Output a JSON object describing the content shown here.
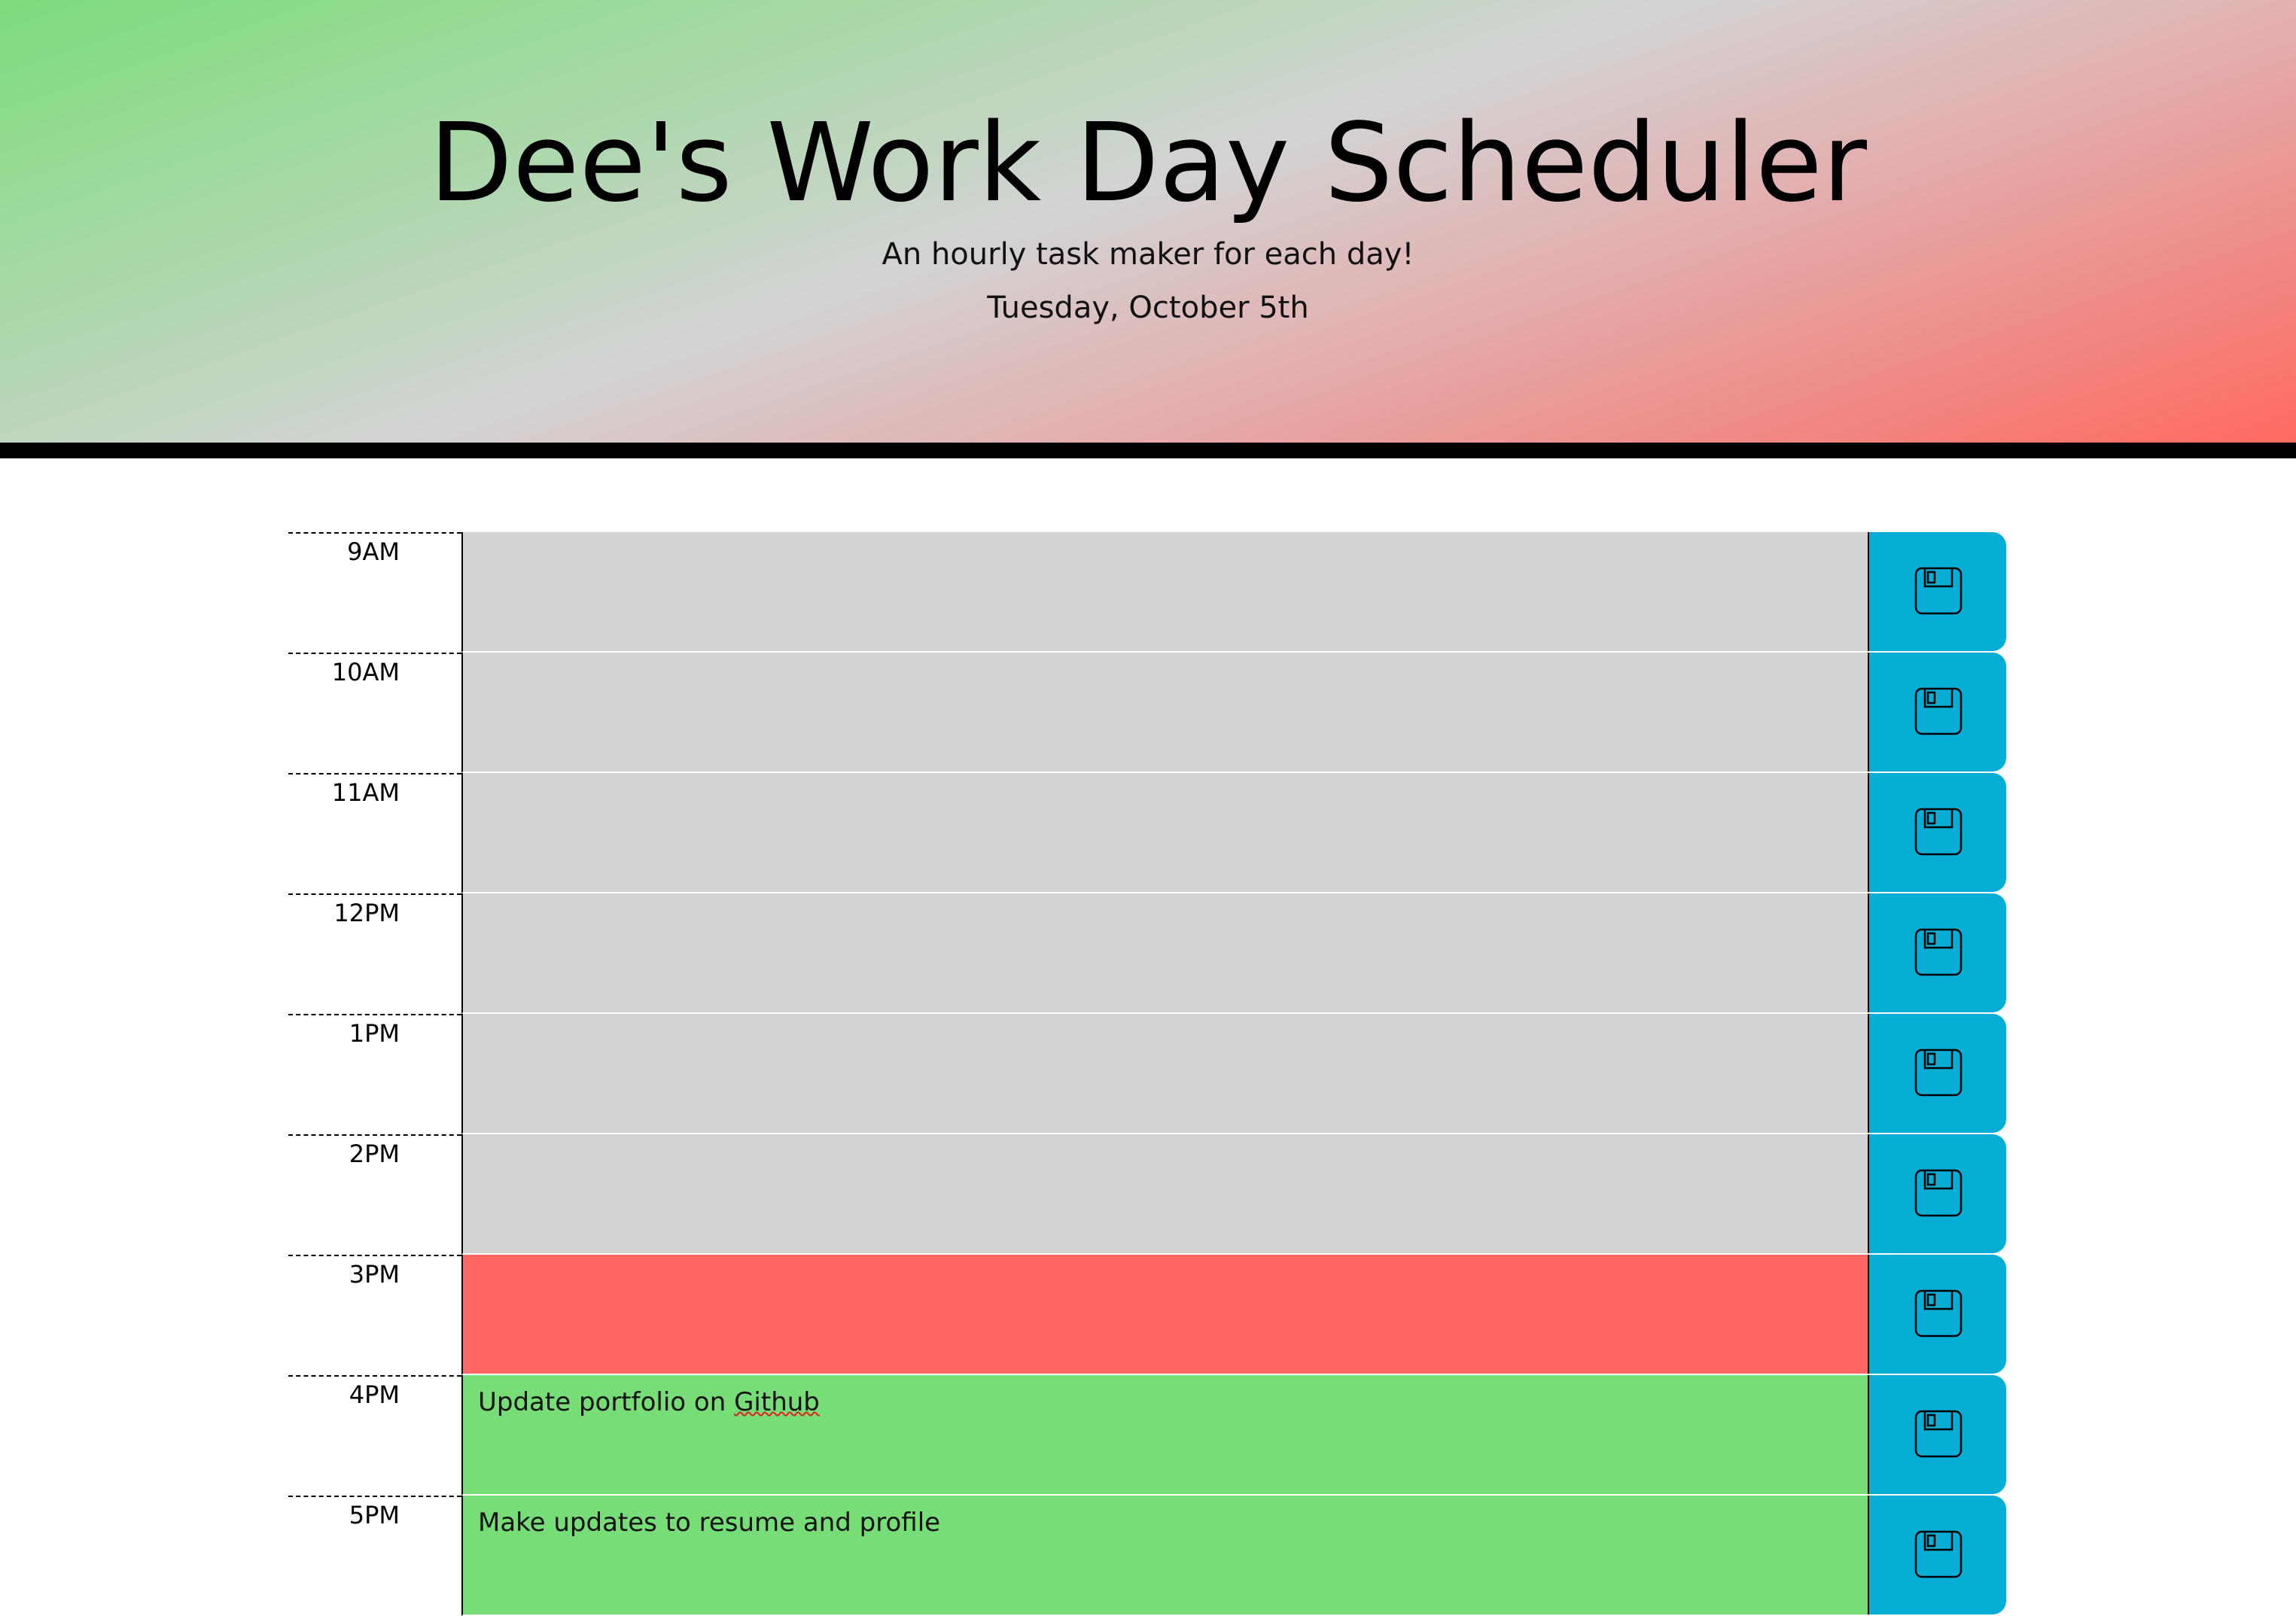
{
  "header": {
    "title": "Dee's Work Day Scheduler",
    "subtitle": "An hourly task maker for each day!",
    "date": "Tuesday, October 5th"
  },
  "colors": {
    "past": "#d3d3d3",
    "present": "#ff6961",
    "future": "#77dd77",
    "save_button": "#06aed5"
  },
  "schedule": {
    "rows": [
      {
        "hour": "9AM",
        "status": "past",
        "text": ""
      },
      {
        "hour": "10AM",
        "status": "past",
        "text": ""
      },
      {
        "hour": "11AM",
        "status": "past",
        "text": ""
      },
      {
        "hour": "12PM",
        "status": "past",
        "text": ""
      },
      {
        "hour": "1PM",
        "status": "past",
        "text": ""
      },
      {
        "hour": "2PM",
        "status": "past",
        "text": ""
      },
      {
        "hour": "3PM",
        "status": "present",
        "text": ""
      },
      {
        "hour": "4PM",
        "status": "future",
        "text_prefix": "Update portfolio on ",
        "text_flagged": "Github"
      },
      {
        "hour": "5PM",
        "status": "future",
        "text": "Make updates to resume and profile"
      }
    ],
    "save_icon": "floppy-disk-icon"
  }
}
